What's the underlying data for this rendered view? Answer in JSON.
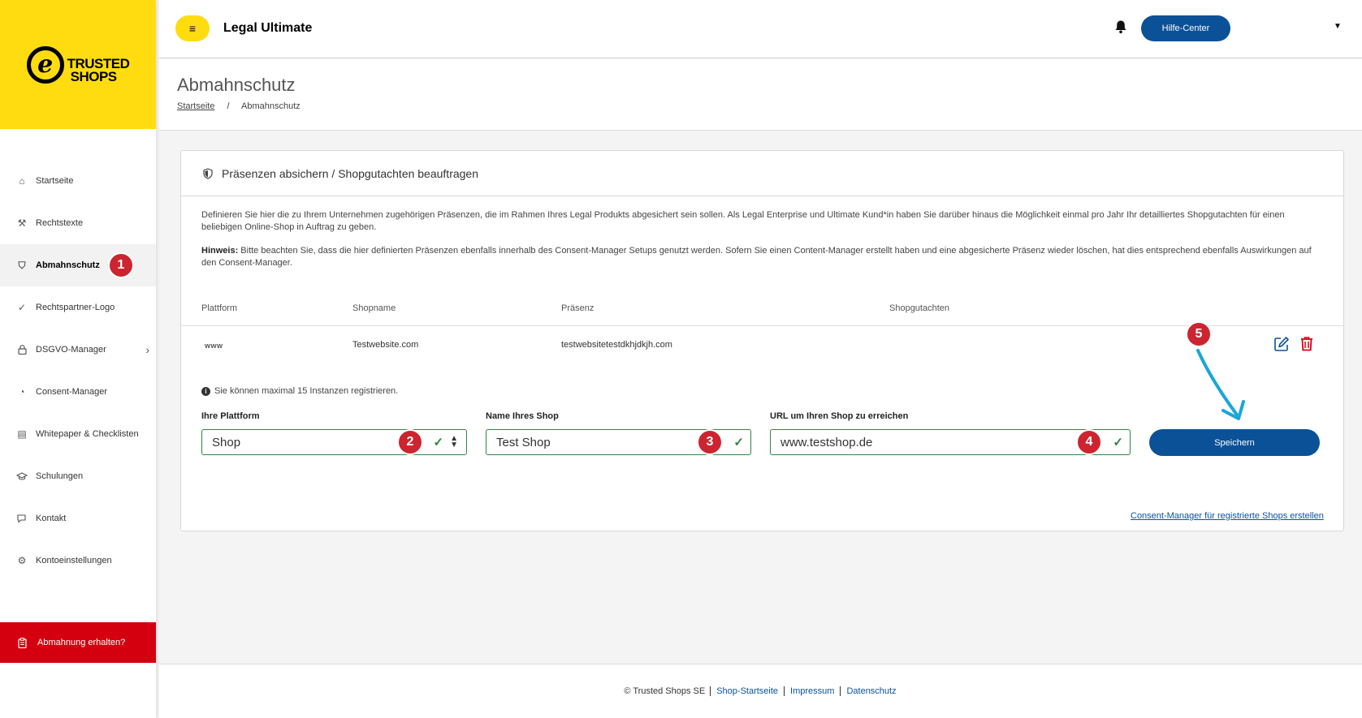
{
  "brand": {
    "logo_mark": "e",
    "logo_line1": "TRUSTED",
    "logo_line2": "SHOPS"
  },
  "sidebar": {
    "items": [
      {
        "label": "Startseite",
        "icon": "home-icon",
        "glyph": "⌂"
      },
      {
        "label": "Rechtstexte",
        "icon": "hammer-icon",
        "glyph": "⚒"
      },
      {
        "label": "Abmahnschutz",
        "icon": "shield-icon",
        "glyph": "⛉",
        "active": true,
        "badge": "1"
      },
      {
        "label": "Rechtspartner-Logo",
        "icon": "check-circle-icon",
        "glyph": "✓"
      },
      {
        "label": "DSGVO-Manager",
        "icon": "lock-icon",
        "glyph": "🔒",
        "chevron": "›"
      },
      {
        "label": "Consent-Manager",
        "icon": "cookie-icon",
        "glyph": "◔"
      },
      {
        "label": "Whitepaper & Checklisten",
        "icon": "document-icon",
        "glyph": "▤"
      },
      {
        "label": "Schulungen",
        "icon": "graduation-cap-icon",
        "glyph": "🎓"
      },
      {
        "label": "Kontakt",
        "icon": "chat-icon",
        "glyph": "✉"
      },
      {
        "label": "Kontoeinstellungen",
        "icon": "gear-icon",
        "glyph": "⚙"
      }
    ],
    "alert_button": {
      "label": "Abmahnung erhalten?",
      "icon": "clipboard-icon"
    }
  },
  "header": {
    "menu_icon": "≡",
    "app_title": "Legal Ultimate",
    "help_label": "Hilfe-Center",
    "account_caret": "▼"
  },
  "page": {
    "title": "Abmahnschutz",
    "breadcrumb": {
      "home": "Startseite",
      "separator": "/",
      "current": "Abmahnschutz"
    }
  },
  "card": {
    "title": "Präsenzen absichern / Shopgutachten beauftragen",
    "description": "Definieren Sie hier die zu Ihrem Unternehmen zugehörigen Präsenzen, die im Rahmen Ihres Legal Produkts abgesichert sein sollen. Als Legal Enterprise und Ultimate Kund*in haben Sie darüber hinaus die Möglichkeit einmal pro Jahr Ihr detailliertes Shopgutachten für einen beliebigen Online-Shop in Auftrag zu geben.",
    "hint_label": "Hinweis:",
    "hint_text": " Bitte beachten Sie, dass die hier definierten Präsenzen ebenfalls innerhalb des Consent-Manager Setups genutzt werden. Sofern Sie einen Content-Manager erstellt haben und eine abgesicherte Präsenz wieder löschen, hat dies entsprechend ebenfalls Auswirkungen auf den Consent-Manager.",
    "table": {
      "headers": [
        "Plattform",
        "Shopname",
        "Präsenz",
        "Shopgutachten"
      ],
      "rows": [
        {
          "platform": "www",
          "shopname": "Testwebsite.com",
          "presence": "testwebsitetestdkhjdkjh.com",
          "report": ""
        }
      ]
    },
    "info_note": "Sie können maximal 15 Instanzen registrieren.",
    "form": {
      "platform": {
        "label": "Ihre Plattform",
        "value": "Shop",
        "badge": "2"
      },
      "shop_name": {
        "label": "Name Ihres Shop",
        "value": "Test Shop",
        "badge": "3"
      },
      "url": {
        "label": "URL um Ihren Shop zu erreichen",
        "value": "www.testshop.de",
        "badge": "4"
      },
      "save_label": "Speichern",
      "save_badge": "5"
    },
    "consent_link": "Consent-Manager für registrierte Shops erstellen"
  },
  "footer": {
    "copyright": "© Trusted Shops SE",
    "links": [
      "Shop-Startseite",
      "Impressum",
      "Datenschutz"
    ]
  },
  "colors": {
    "brand_yellow": "#ffdc0f",
    "primary_blue": "#0a5198",
    "alert_red": "#d5000f",
    "badge_red": "#cc2530",
    "valid_green": "#2e8540",
    "arrow_cyan": "#1aa6d8"
  }
}
